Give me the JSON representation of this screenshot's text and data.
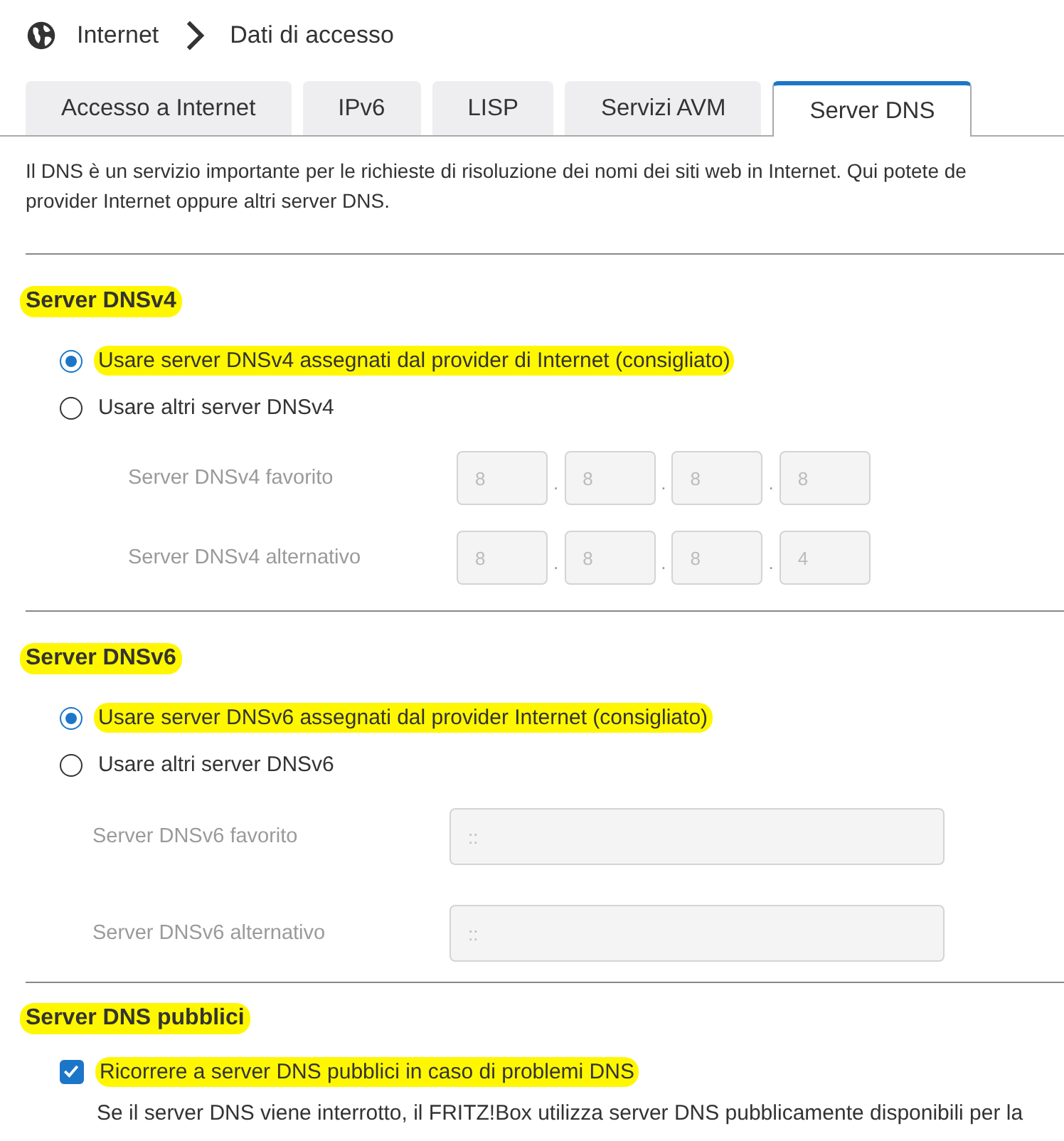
{
  "breadcrumb": {
    "items": [
      "Internet",
      "Dati di accesso"
    ]
  },
  "tabs": [
    {
      "label": "Accesso a Internet",
      "selected": false
    },
    {
      "label": "IPv6",
      "selected": false
    },
    {
      "label": "LISP",
      "selected": false
    },
    {
      "label": "Servizi AVM",
      "selected": false
    },
    {
      "label": "Server DNS",
      "selected": true
    }
  ],
  "intro": [
    "Il DNS è un servizio importante per le richieste di risoluzione dei nomi dei siti web in Internet. Qui potete de",
    "provider Internet oppure altri server DNS."
  ],
  "sections": [
    {
      "title": "Server DNSv4",
      "highlighted": true,
      "options": [
        {
          "kind": "radio",
          "label": "Usare server DNSv4 assegnati dal provider di Internet (consigliato)",
          "selected": true,
          "highlighted": true
        },
        {
          "kind": "radio",
          "label": "Usare altri server DNSv4",
          "selected": false,
          "highlighted": false
        }
      ],
      "fields": [
        {
          "kind": "ipv4",
          "label": "Server DNSv4 favorito",
          "disabled": true,
          "separator": ".",
          "octets": [
            "8",
            "8",
            "8",
            "8"
          ]
        },
        {
          "kind": "ipv4",
          "label": "Server DNSv4 alternativo",
          "disabled": true,
          "separator": ".",
          "octets": [
            "8",
            "8",
            "8",
            "4"
          ]
        }
      ]
    },
    {
      "title": "Server DNSv6",
      "highlighted": true,
      "options": [
        {
          "kind": "radio",
          "label": "Usare server DNSv6 assegnati dal provider Internet (consigliato)",
          "selected": true,
          "highlighted": true
        },
        {
          "kind": "radio",
          "label": "Usare altri server DNSv6",
          "selected": false,
          "highlighted": false
        }
      ],
      "fields": [
        {
          "kind": "ipv6",
          "label": "Server DNSv6 favorito",
          "disabled": true,
          "placeholder": "::"
        },
        {
          "kind": "ipv6",
          "label": "Server DNSv6 alternativo",
          "disabled": true,
          "placeholder": "::"
        }
      ]
    },
    {
      "title": "Server DNS pubblici",
      "highlighted": true,
      "options": [
        {
          "kind": "checkbox",
          "label": "Ricorrere a server DNS pubblici in caso di problemi DNS",
          "checked": true,
          "highlighted": true
        }
      ],
      "note": "Se il server DNS viene interrotto, il FRITZ!Box utilizza server DNS pubblicamente disponibili per la"
    }
  ]
}
